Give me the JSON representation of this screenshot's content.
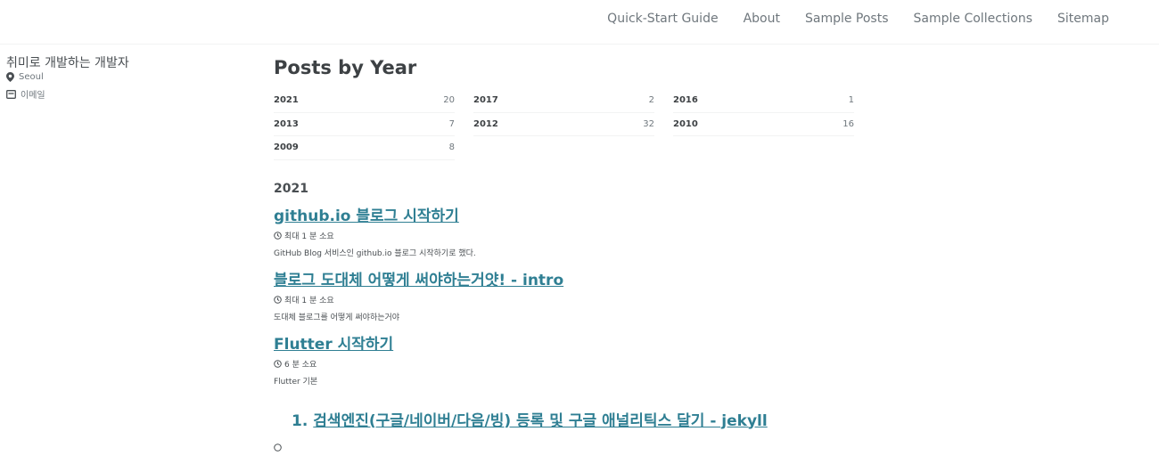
{
  "nav": {
    "items": [
      "Quick-Start Guide",
      "About",
      "Sample Posts",
      "Sample Collections",
      "Sitemap"
    ]
  },
  "author": {
    "name": "취미로 개발하는 개발자",
    "location": "Seoul",
    "email_label": "이메일"
  },
  "page": {
    "title": "Posts by Year"
  },
  "years": [
    {
      "year": "2021",
      "count": "20"
    },
    {
      "year": "2017",
      "count": "2"
    },
    {
      "year": "2016",
      "count": "1"
    },
    {
      "year": "2013",
      "count": "7"
    },
    {
      "year": "2012",
      "count": "32"
    },
    {
      "year": "2010",
      "count": "16"
    },
    {
      "year": "2009",
      "count": "8"
    }
  ],
  "section": {
    "year": "2021"
  },
  "posts": [
    {
      "title": "github.io 블로그 시작하기",
      "meta": "최대 1 분 소요",
      "excerpt": "GitHub Blog 서비스인 github.io 블로그 시작하기로 했다."
    },
    {
      "title": "블로그 도대체 어떻게 써야하는거얏! - intro",
      "meta": "최대 1 분 소요",
      "excerpt": "도대체 블로그를 어떻게 써야하는거야"
    },
    {
      "title": "Flutter 시작하기",
      "meta": "6 분 소요",
      "excerpt": "Flutter 기본"
    }
  ],
  "ordered_post": {
    "number": "1.",
    "title": "검색엔진(구글/네이버/다음/빙) 등록 및 구글 애널리틱스 달기 - jekyll"
  },
  "icons": {
    "location": "map-marker-icon",
    "email": "envelope-icon",
    "clock": "clock-icon"
  },
  "colors": {
    "link": "#2f7f93",
    "text": "#494e52",
    "muted": "#6f777d"
  }
}
